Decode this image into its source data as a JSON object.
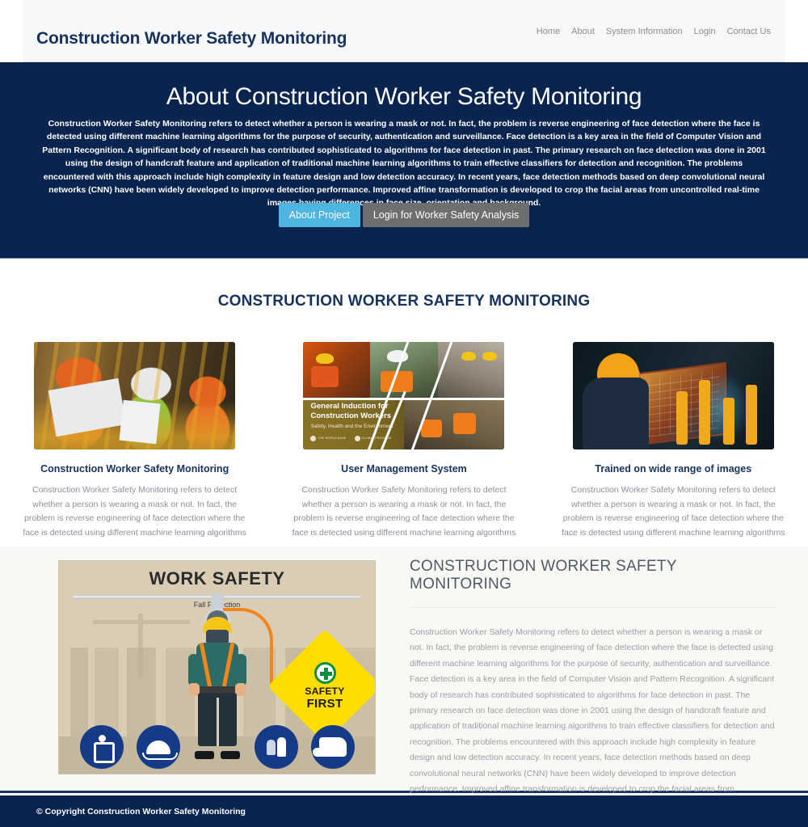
{
  "header": {
    "brand": "Construction Worker Safety Monitoring",
    "nav": [
      {
        "label": "Home"
      },
      {
        "label": "About"
      },
      {
        "label": "System Information"
      },
      {
        "label": "Login"
      },
      {
        "label": "Contact Us"
      }
    ]
  },
  "hero": {
    "title": "About Construction Worker Safety Monitoring",
    "paragraph": "Construction Worker Safety Monitoring refers to detect whether a person is wearing a mask or not. In fact, the problem is reverse engineering of face detection where the face is detected using different machine learning algorithms for the purpose of security, authentication and surveillance. Face detection is a key area in the field of Computer Vision and Pattern Recognition. A significant body of research has contributed sophisticated to algorithms for face detection in past. The primary research on face detection was done in 2001 using the design of handcraft feature and application of traditional machine learning algorithms to train effective classifiers for detection and recognition. The problems encountered with this approach include high complexity in feature design and low detection accuracy. In recent years, face detection methods based on deep convolutional neural networks (CNN) have been widely developed to improve detection performance. Improved affine transformation is developed to crop the facial areas from uncontrolled real-time images having differences in face size, orientation and background.",
    "primary_button": "About Project",
    "secondary_button": "Login for Worker Safety Analysis",
    "background_color": "#09244f",
    "primary_button_color": "#4cb5e0",
    "secondary_button_color": "#6e6e6e"
  },
  "features": {
    "heading": "CONSTRUCTION WORKER SAFETY MONITORING",
    "cards": [
      {
        "title": "Construction Worker Safety Monitoring",
        "text": "Construction Worker Safety Monitoring refers to detect whether a person is wearing a mask or not. In fact, the problem is reverse engineering of face detection where the face is detected using different machine learning algorithms",
        "image_alt": "construction-workers-reviewing-blueprint-photo"
      },
      {
        "title": "User Management System",
        "text": "Construction Worker Safety Monitoring refers to detect whether a person is wearing a mask or not. In fact, the problem is reverse engineering of face detection where the face is detected using different machine learning algorithms",
        "image_alt": "general-induction-for-construction-workers-collage",
        "overlay_title": "General Induction for Construction Workers",
        "overlay_subtitle": "Safety, Health and the Environment",
        "overlay_logo_1": "THE WORLD BANK",
        "overlay_logo_2": "GLOBAL PROGRAM"
      },
      {
        "title": "Trained on wide range of images",
        "text": "Construction Worker Safety Monitoring refers to detect whether a person is wearing a mask or not. In fact, the problem is reverse engineering of face detection where the face is detected using different machine learning algorithms",
        "image_alt": "worker-with-holographic-industrial-hud-photo"
      }
    ]
  },
  "about": {
    "heading": "CONSTRUCTION WORKER SAFETY MONITORING",
    "paragraph": "Construction Worker Safety Monitoring refers to detect whether a person is wearing a mask or not. In fact, the problem is reverse engineering of face detection where the face is detected using different machine learning algorithms for the purpose of security, authentication and surveillance. Face detection is a key area in the field of Computer Vision and Pattern Recognition. A significant body of research has contributed sophisticated to algorithms for face detection in past. The primary research on face detection was done in 2001 using the design of handcraft feature and application of traditional machine learning algorithms to train effective classifiers for detection and recognition. The problems encountered with this approach include high complexity in feature design and low detection accuracy. In recent years, face detection methods based on deep convolutional neural networks (CNN) have been widely developed to improve detection performance. Improved affine transformation is developed to crop the facial areas from uncontrolled real-time images having differences in face size, orientation and background.",
    "poster": {
      "title": "WORK SAFETY",
      "caption": "Fall Protection",
      "sign_line1": "SAFETY",
      "sign_line2": "FIRST",
      "icons": [
        {
          "name": "fall-harness-icon"
        },
        {
          "name": "hard-hat-icon"
        },
        {
          "name": "safety-gloves-icon"
        },
        {
          "name": "safety-boots-icon"
        }
      ]
    }
  },
  "footer": {
    "copyright": "© Copyright Construction Worker Safety Monitoring",
    "background_color": "#09244f"
  }
}
